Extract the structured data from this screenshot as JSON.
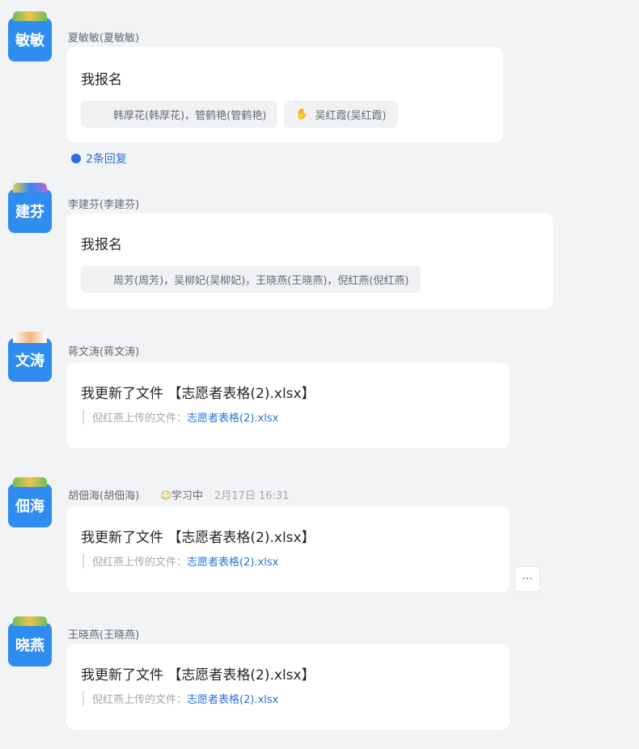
{
  "messages": [
    {
      "avatar": "敏敏",
      "sender": "夏敏敏(夏敏敏)",
      "text": "我报名",
      "reactions": [
        "韩厚花(韩厚花)，管鹤艳(管鹤艳)",
        "吴红霞(吴红霞)"
      ],
      "reply": "2条回复"
    },
    {
      "avatar": "建芬",
      "sender": "李建芬(李建芬)",
      "text": "我报名",
      "reactions": [
        "周芳(周芳)，吴柳妃(吴柳妃)，王晓燕(王晓燕)，倪红燕(倪红燕)"
      ]
    },
    {
      "avatar": "文涛",
      "sender": "蒋文涛(蒋文涛)",
      "text": "我更新了文件 【志愿者表格(2).xlsx】",
      "file_prefix": "倪红燕上传的文件：",
      "file_name": "志愿者表格(2).xlsx"
    },
    {
      "avatar": "佃海",
      "sender": "胡佃海(胡佃海)",
      "status": "学习中",
      "time": "2月17日 16:31",
      "text": "我更新了文件 【志愿者表格(2).xlsx】",
      "file_prefix": "倪红燕上传的文件：",
      "file_name": "志愿者表格(2).xlsx"
    },
    {
      "avatar": "晓燕",
      "sender": "王晓燕(王晓燕)",
      "text": "我更新了文件 【志愿者表格(2).xlsx】",
      "file_prefix": "倪红燕上传的文件：",
      "file_name": "志愿者表格(2).xlsx"
    }
  ],
  "more_label": "···",
  "icons": {
    "reply": "comment-dot-icon",
    "reaction": "thumb-icon",
    "status": "smile-icon",
    "more": "ellipsis-icon"
  },
  "colors": {
    "avatar": "#2f8cf0",
    "link": "#2a6fe1",
    "background": "#f2f3f5"
  }
}
